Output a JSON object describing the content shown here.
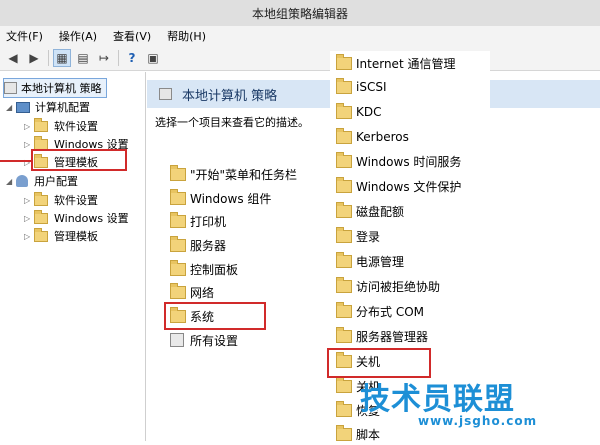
{
  "window": {
    "title": "本地组策略编辑器"
  },
  "menu": {
    "items": [
      "文件(F)",
      "操作(A)",
      "查看(V)",
      "帮助(H)"
    ]
  },
  "toolbar": {
    "icons": [
      "back-arrow-icon",
      "forward-arrow-icon",
      "show-tree-icon",
      "properties-icon",
      "export-list-icon",
      "help-icon",
      "view-toggle-icon"
    ]
  },
  "tree": {
    "root": "本地计算机 策略",
    "computer": "计算机配置",
    "computer_children": [
      "软件设置",
      "Windows 设置",
      "管理模板"
    ],
    "user": "用户配置",
    "user_children": [
      "软件设置",
      "Windows 设置",
      "管理模板"
    ]
  },
  "main": {
    "header": "本地计算机 策略",
    "description": "选择一个项目来查看它的描述。"
  },
  "admin_templates_list": {
    "items": [
      "\"开始\"菜单和任务栏",
      "Windows 组件",
      "打印机",
      "服务器",
      "控制面板",
      "网络",
      "系统"
    ],
    "all_settings": "所有设置"
  },
  "system_list": {
    "items": [
      "Internet 通信管理",
      "iSCSI",
      "KDC",
      "Kerberos",
      "Windows 时间服务",
      "Windows 文件保护",
      "磁盘配额",
      "登录",
      "电源管理",
      "访问被拒绝协助",
      "分布式 COM",
      "服务器管理器",
      "关机",
      "关机",
      "恢复",
      "脚本"
    ]
  },
  "watermark": {
    "text": "技术员联盟",
    "url": "www.jsgho.com"
  },
  "colors": {
    "highlight_box": "#d12a2a",
    "header_bg": "#d8e6f5",
    "folder": "#f2d37a",
    "watermark": "#1d8fd6"
  }
}
